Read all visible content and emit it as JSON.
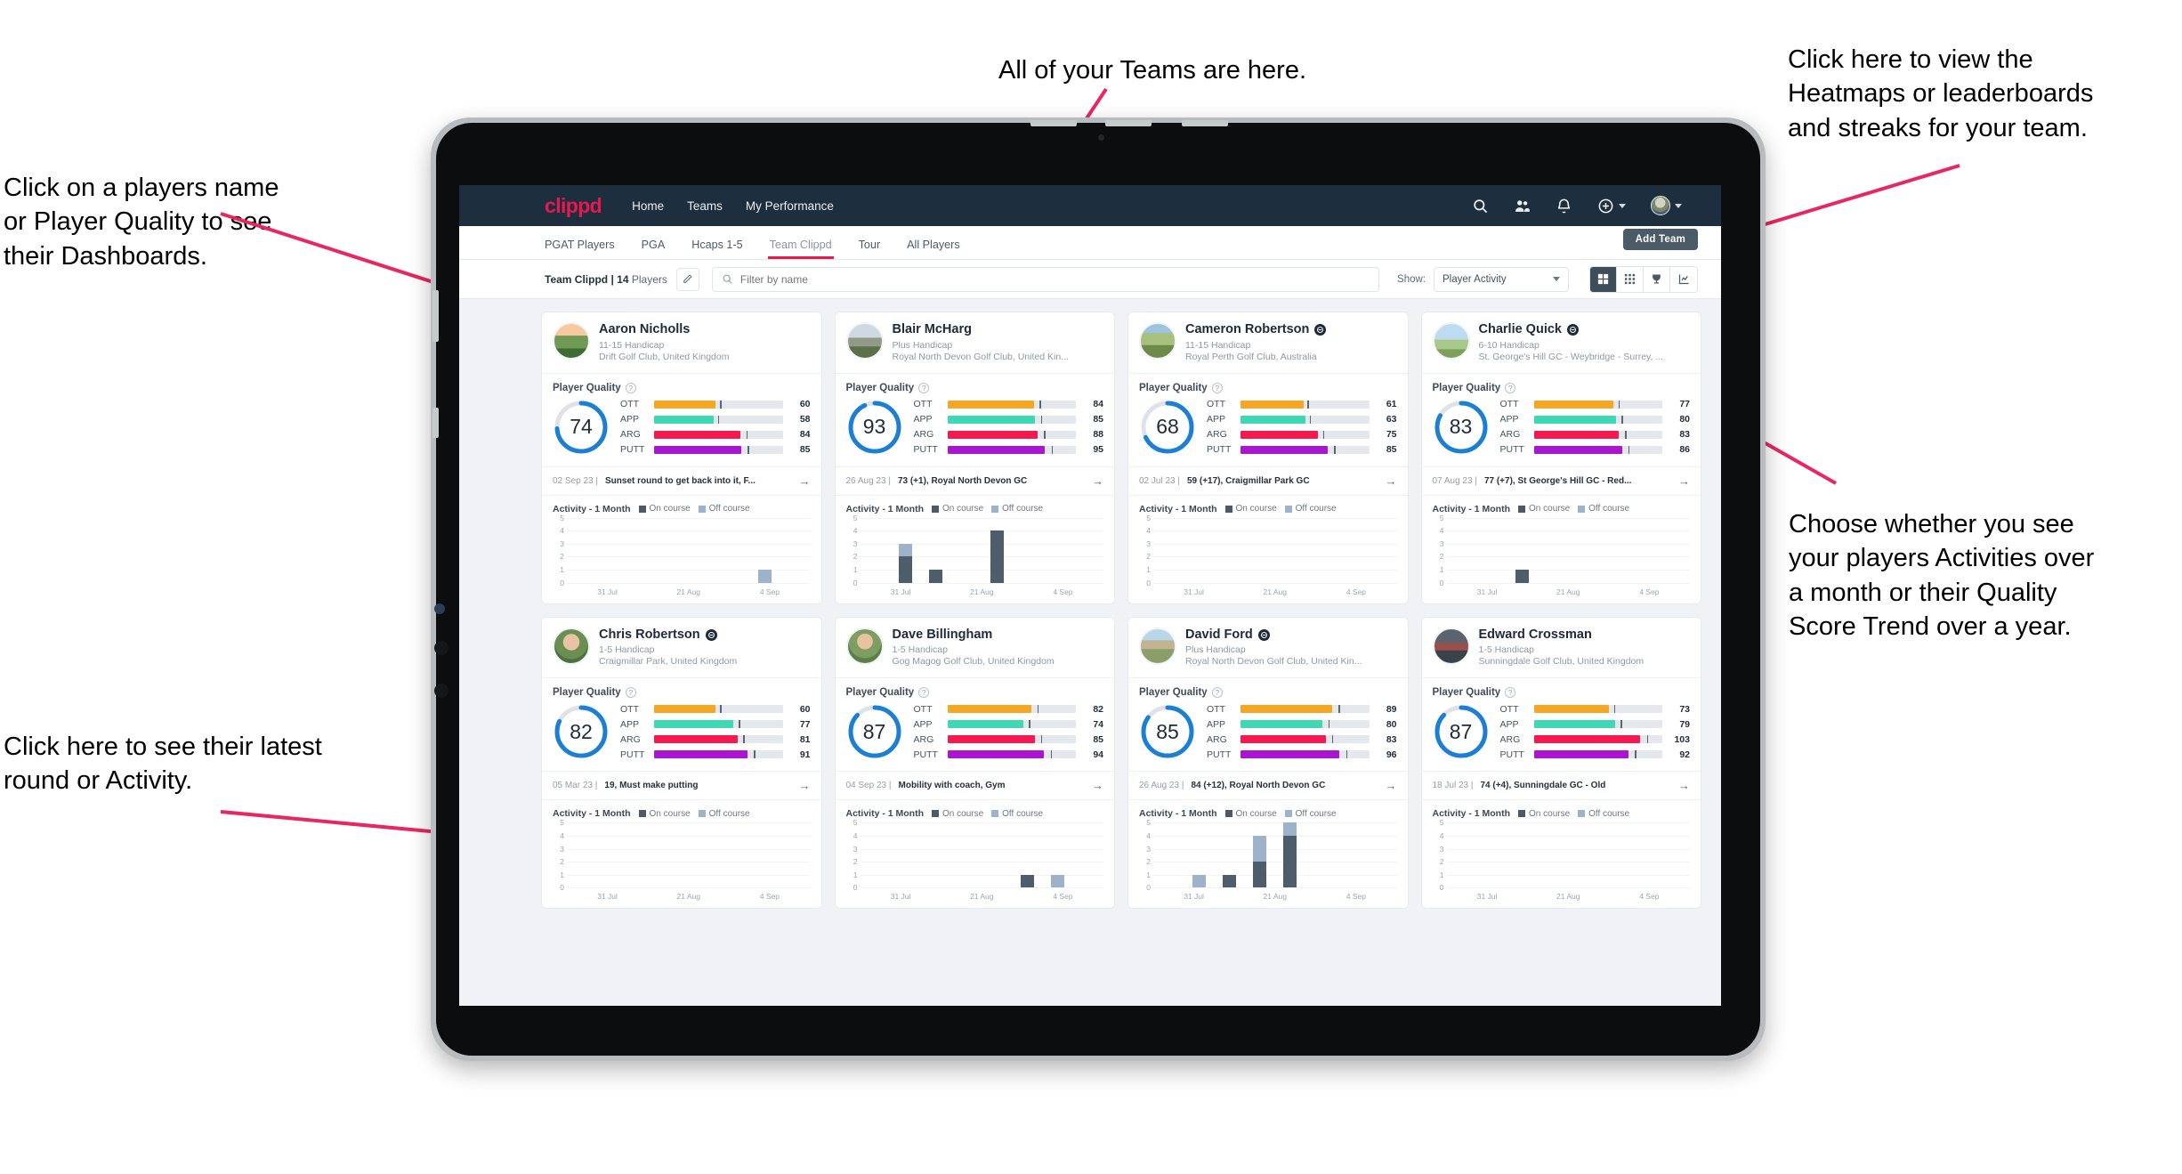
{
  "annotations": [
    {
      "id": "teams",
      "text": "All of your Teams are here."
    },
    {
      "id": "heatmaps",
      "text": "Click here to view the\nHeatmaps or leaderboards\nand streaks for your team."
    },
    {
      "id": "players-name",
      "text": "Click on a players name\nor Player Quality to see\ntheir Dashboards."
    },
    {
      "id": "activity-choice",
      "text": "Choose whether you see\nyour players Activities over\na month or their Quality\nScore Trend over a year."
    },
    {
      "id": "latest-round",
      "text": "Click here to see their latest\nround or Activity."
    }
  ],
  "nav": {
    "logo": "clippd",
    "links": [
      "Home",
      "Teams",
      "My Performance"
    ],
    "icons": [
      "search-icon",
      "users-icon",
      "bell-icon",
      "plus-circle-icon",
      "avatar"
    ]
  },
  "subtabs": [
    {
      "label": "PGAT Players",
      "active": false
    },
    {
      "label": "PGA",
      "active": false
    },
    {
      "label": "Hcaps 1-5",
      "active": false
    },
    {
      "label": "Team Clippd",
      "active": true
    },
    {
      "label": "Tour",
      "active": false
    },
    {
      "label": "All Players",
      "active": false
    }
  ],
  "add_team_label": "Add Team",
  "toolbar": {
    "team_name": "Team Clippd",
    "separator": " | ",
    "player_count": "14",
    "players_word": " Players",
    "search_placeholder": "Filter by name",
    "show_label": "Show:",
    "show_value": "Player Activity",
    "view_buttons": [
      "grid-large-icon",
      "grid-small-icon",
      "trophy-icon",
      "chart-trend-icon"
    ]
  },
  "colors": {
    "accent": "#e8174e",
    "nav_bg": "#1d2f3e",
    "ring": "#1b7fd4",
    "ott": "#f5a623",
    "app": "#3fd8b6",
    "arg": "#f5194f",
    "putt": "#a915d0",
    "on_course": "#4d5d6b",
    "off_course": "#9cb3c9"
  },
  "quality": {
    "section_label": "Player Quality",
    "metric_labels": [
      "OTT",
      "APP",
      "ARG",
      "PUTT"
    ]
  },
  "activity": {
    "label": "Activity - 1 Month",
    "legend": [
      "On course",
      "Off course"
    ],
    "y_ticks": [
      "5",
      "4",
      "3",
      "2",
      "1",
      "0"
    ],
    "x_ticks": [
      "31 Jul",
      "21 Aug",
      "4 Sep"
    ]
  },
  "players": [
    {
      "name": "Aaron Nicholls",
      "verified": false,
      "handicap": "11-15 Handicap",
      "club": "Drift Golf Club, United Kingdom",
      "quality_score": 74,
      "metrics": [
        {
          "label": "OTT",
          "value": 60,
          "color": "#f5a623"
        },
        {
          "label": "APP",
          "value": 58,
          "color": "#3fd8b6"
        },
        {
          "label": "ARG",
          "value": 84,
          "color": "#f5194f"
        },
        {
          "label": "PUTT",
          "value": 85,
          "color": "#a915d0"
        }
      ],
      "last_date": "02 Sep 23",
      "last_text": "Sunset round to get back into it, F...",
      "chart_data": {
        "type": "bar",
        "title": "Activity - 1 Month",
        "x_ticks": [
          "31 Jul",
          "21 Aug",
          "4 Sep"
        ],
        "ylim": [
          0,
          5
        ],
        "bars": [
          {
            "on": 0,
            "off": 0
          },
          {
            "on": 0,
            "off": 0
          },
          {
            "on": 0,
            "off": 0
          },
          {
            "on": 0,
            "off": 0
          },
          {
            "on": 0,
            "off": 0
          },
          {
            "on": 0,
            "off": 0
          },
          {
            "on": 0,
            "off": 1
          },
          {
            "on": 0,
            "off": 0
          }
        ]
      }
    },
    {
      "name": "Blair McHarg",
      "verified": false,
      "handicap": "Plus Handicap",
      "club": "Royal North Devon Golf Club, United Kin...",
      "quality_score": 93,
      "metrics": [
        {
          "label": "OTT",
          "value": 84,
          "color": "#f5a623"
        },
        {
          "label": "APP",
          "value": 85,
          "color": "#3fd8b6"
        },
        {
          "label": "ARG",
          "value": 88,
          "color": "#f5194f"
        },
        {
          "label": "PUTT",
          "value": 95,
          "color": "#a915d0"
        }
      ],
      "last_date": "26 Aug 23",
      "last_text": "73 (+1), Royal North Devon GC",
      "chart_data": {
        "type": "bar",
        "title": "Activity - 1 Month",
        "x_ticks": [
          "31 Jul",
          "21 Aug",
          "4 Sep"
        ],
        "ylim": [
          0,
          5
        ],
        "bars": [
          {
            "on": 0,
            "off": 0
          },
          {
            "on": 2,
            "off": 1
          },
          {
            "on": 1,
            "off": 0
          },
          {
            "on": 0,
            "off": 0
          },
          {
            "on": 4,
            "off": 0
          },
          {
            "on": 0,
            "off": 0
          },
          {
            "on": 0,
            "off": 0
          },
          {
            "on": 0,
            "off": 0
          }
        ]
      }
    },
    {
      "name": "Cameron Robertson",
      "verified": true,
      "handicap": "11-15 Handicap",
      "club": "Royal Perth Golf Club, Australia",
      "quality_score": 68,
      "metrics": [
        {
          "label": "OTT",
          "value": 61,
          "color": "#f5a623"
        },
        {
          "label": "APP",
          "value": 63,
          "color": "#3fd8b6"
        },
        {
          "label": "ARG",
          "value": 75,
          "color": "#f5194f"
        },
        {
          "label": "PUTT",
          "value": 85,
          "color": "#a915d0"
        }
      ],
      "last_date": "02 Jul 23",
      "last_text": "59 (+17), Craigmillar Park GC",
      "chart_data": {
        "type": "bar",
        "title": "Activity - 1 Month",
        "x_ticks": [
          "31 Jul",
          "21 Aug",
          "4 Sep"
        ],
        "ylim": [
          0,
          5
        ],
        "bars": [
          {
            "on": 0,
            "off": 0
          },
          {
            "on": 0,
            "off": 0
          },
          {
            "on": 0,
            "off": 0
          },
          {
            "on": 0,
            "off": 0
          },
          {
            "on": 0,
            "off": 0
          },
          {
            "on": 0,
            "off": 0
          },
          {
            "on": 0,
            "off": 0
          },
          {
            "on": 0,
            "off": 0
          }
        ]
      }
    },
    {
      "name": "Charlie Quick",
      "verified": true,
      "handicap": "6-10 Handicap",
      "club": "St. George's Hill GC - Weybridge - Surrey, ...",
      "quality_score": 83,
      "metrics": [
        {
          "label": "OTT",
          "value": 77,
          "color": "#f5a623"
        },
        {
          "label": "APP",
          "value": 80,
          "color": "#3fd8b6"
        },
        {
          "label": "ARG",
          "value": 83,
          "color": "#f5194f"
        },
        {
          "label": "PUTT",
          "value": 86,
          "color": "#a915d0"
        }
      ],
      "last_date": "07 Aug 23",
      "last_text": "77 (+7), St George's Hill GC - Red...",
      "chart_data": {
        "type": "bar",
        "title": "Activity - 1 Month",
        "x_ticks": [
          "31 Jul",
          "21 Aug",
          "4 Sep"
        ],
        "ylim": [
          0,
          5
        ],
        "bars": [
          {
            "on": 0,
            "off": 0
          },
          {
            "on": 0,
            "off": 0
          },
          {
            "on": 1,
            "off": 0
          },
          {
            "on": 0,
            "off": 0
          },
          {
            "on": 0,
            "off": 0
          },
          {
            "on": 0,
            "off": 0
          },
          {
            "on": 0,
            "off": 0
          },
          {
            "on": 0,
            "off": 0
          }
        ]
      }
    },
    {
      "name": "Chris Robertson",
      "verified": true,
      "handicap": "1-5 Handicap",
      "club": "Craigmillar Park, United Kingdom",
      "quality_score": 82,
      "metrics": [
        {
          "label": "OTT",
          "value": 60,
          "color": "#f5a623"
        },
        {
          "label": "APP",
          "value": 77,
          "color": "#3fd8b6"
        },
        {
          "label": "ARG",
          "value": 81,
          "color": "#f5194f"
        },
        {
          "label": "PUTT",
          "value": 91,
          "color": "#a915d0"
        }
      ],
      "last_date": "05 Mar 23",
      "last_text": "19, Must make putting",
      "chart_data": {
        "type": "bar",
        "title": "Activity - 1 Month",
        "x_ticks": [
          "31 Jul",
          "21 Aug",
          "4 Sep"
        ],
        "ylim": [
          0,
          5
        ],
        "bars": [
          {
            "on": 0,
            "off": 0
          },
          {
            "on": 0,
            "off": 0
          },
          {
            "on": 0,
            "off": 0
          },
          {
            "on": 0,
            "off": 0
          },
          {
            "on": 0,
            "off": 0
          },
          {
            "on": 0,
            "off": 0
          },
          {
            "on": 0,
            "off": 0
          },
          {
            "on": 0,
            "off": 0
          }
        ]
      }
    },
    {
      "name": "Dave Billingham",
      "verified": false,
      "handicap": "1-5 Handicap",
      "club": "Gog Magog Golf Club, United Kingdom",
      "quality_score": 87,
      "metrics": [
        {
          "label": "OTT",
          "value": 82,
          "color": "#f5a623"
        },
        {
          "label": "APP",
          "value": 74,
          "color": "#3fd8b6"
        },
        {
          "label": "ARG",
          "value": 85,
          "color": "#f5194f"
        },
        {
          "label": "PUTT",
          "value": 94,
          "color": "#a915d0"
        }
      ],
      "last_date": "04 Sep 23",
      "last_text": "Mobility with coach, Gym",
      "chart_data": {
        "type": "bar",
        "title": "Activity - 1 Month",
        "x_ticks": [
          "31 Jul",
          "21 Aug",
          "4 Sep"
        ],
        "ylim": [
          0,
          5
        ],
        "bars": [
          {
            "on": 0,
            "off": 0
          },
          {
            "on": 0,
            "off": 0
          },
          {
            "on": 0,
            "off": 0
          },
          {
            "on": 0,
            "off": 0
          },
          {
            "on": 0,
            "off": 0
          },
          {
            "on": 1,
            "off": 0
          },
          {
            "on": 0,
            "off": 1
          },
          {
            "on": 0,
            "off": 0
          }
        ]
      }
    },
    {
      "name": "David Ford",
      "verified": true,
      "handicap": "Plus Handicap",
      "club": "Royal North Devon Golf Club, United Kin...",
      "quality_score": 85,
      "metrics": [
        {
          "label": "OTT",
          "value": 89,
          "color": "#f5a623"
        },
        {
          "label": "APP",
          "value": 80,
          "color": "#3fd8b6"
        },
        {
          "label": "ARG",
          "value": 83,
          "color": "#f5194f"
        },
        {
          "label": "PUTT",
          "value": 96,
          "color": "#a915d0"
        }
      ],
      "last_date": "26 Aug 23",
      "last_text": "84 (+12), Royal North Devon GC",
      "chart_data": {
        "type": "bar",
        "title": "Activity - 1 Month",
        "x_ticks": [
          "31 Jul",
          "21 Aug",
          "4 Sep"
        ],
        "ylim": [
          0,
          5
        ],
        "bars": [
          {
            "on": 0,
            "off": 0
          },
          {
            "on": 0,
            "off": 1
          },
          {
            "on": 1,
            "off": 0
          },
          {
            "on": 2,
            "off": 2
          },
          {
            "on": 4,
            "off": 1
          },
          {
            "on": 0,
            "off": 0
          },
          {
            "on": 0,
            "off": 0
          },
          {
            "on": 0,
            "off": 0
          }
        ]
      }
    },
    {
      "name": "Edward Crossman",
      "verified": false,
      "handicap": "1-5 Handicap",
      "club": "Sunningdale Golf Club, United Kingdom",
      "quality_score": 87,
      "metrics": [
        {
          "label": "OTT",
          "value": 73,
          "color": "#f5a623"
        },
        {
          "label": "APP",
          "value": 79,
          "color": "#3fd8b6"
        },
        {
          "label": "ARG",
          "value": 103,
          "color": "#f5194f"
        },
        {
          "label": "PUTT",
          "value": 92,
          "color": "#a915d0"
        }
      ],
      "last_date": "18 Jul 23",
      "last_text": "74 (+4), Sunningdale GC - Old",
      "chart_data": {
        "type": "bar",
        "title": "Activity - 1 Month",
        "x_ticks": [
          "31 Jul",
          "21 Aug",
          "4 Sep"
        ],
        "ylim": [
          0,
          5
        ],
        "bars": [
          {
            "on": 0,
            "off": 0
          },
          {
            "on": 0,
            "off": 0
          },
          {
            "on": 0,
            "off": 0
          },
          {
            "on": 0,
            "off": 0
          },
          {
            "on": 0,
            "off": 0
          },
          {
            "on": 0,
            "off": 0
          },
          {
            "on": 0,
            "off": 0
          },
          {
            "on": 0,
            "off": 0
          }
        ]
      }
    }
  ]
}
